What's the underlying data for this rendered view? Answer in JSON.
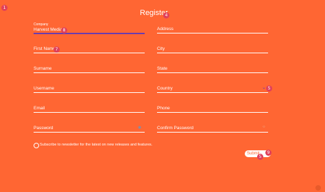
{
  "title": "Register",
  "fields": {
    "company": {
      "label": "Company",
      "value": "Harvest Media"
    },
    "address": {
      "label": "Address"
    },
    "first_name": {
      "label": "First Name"
    },
    "city": {
      "label": "City"
    },
    "surname": {
      "label": "Surname"
    },
    "state": {
      "label": "State"
    },
    "username": {
      "label": "Username"
    },
    "country": {
      "label": "Country"
    },
    "email": {
      "label": "Email"
    },
    "phone": {
      "label": "Phone"
    },
    "password": {
      "label": "Password"
    },
    "confirm_password": {
      "label": "Confirm Password"
    }
  },
  "newsletter_label": "Subscribe to newsletter for the latest on new releases and features.",
  "submit_label": "Submit",
  "badges": [
    "1",
    "4",
    "8",
    "7",
    "5",
    "9",
    "5"
  ],
  "colors": {
    "background": "#ff6633",
    "accent": "#6a3bb0",
    "badge": "#e0405a"
  }
}
